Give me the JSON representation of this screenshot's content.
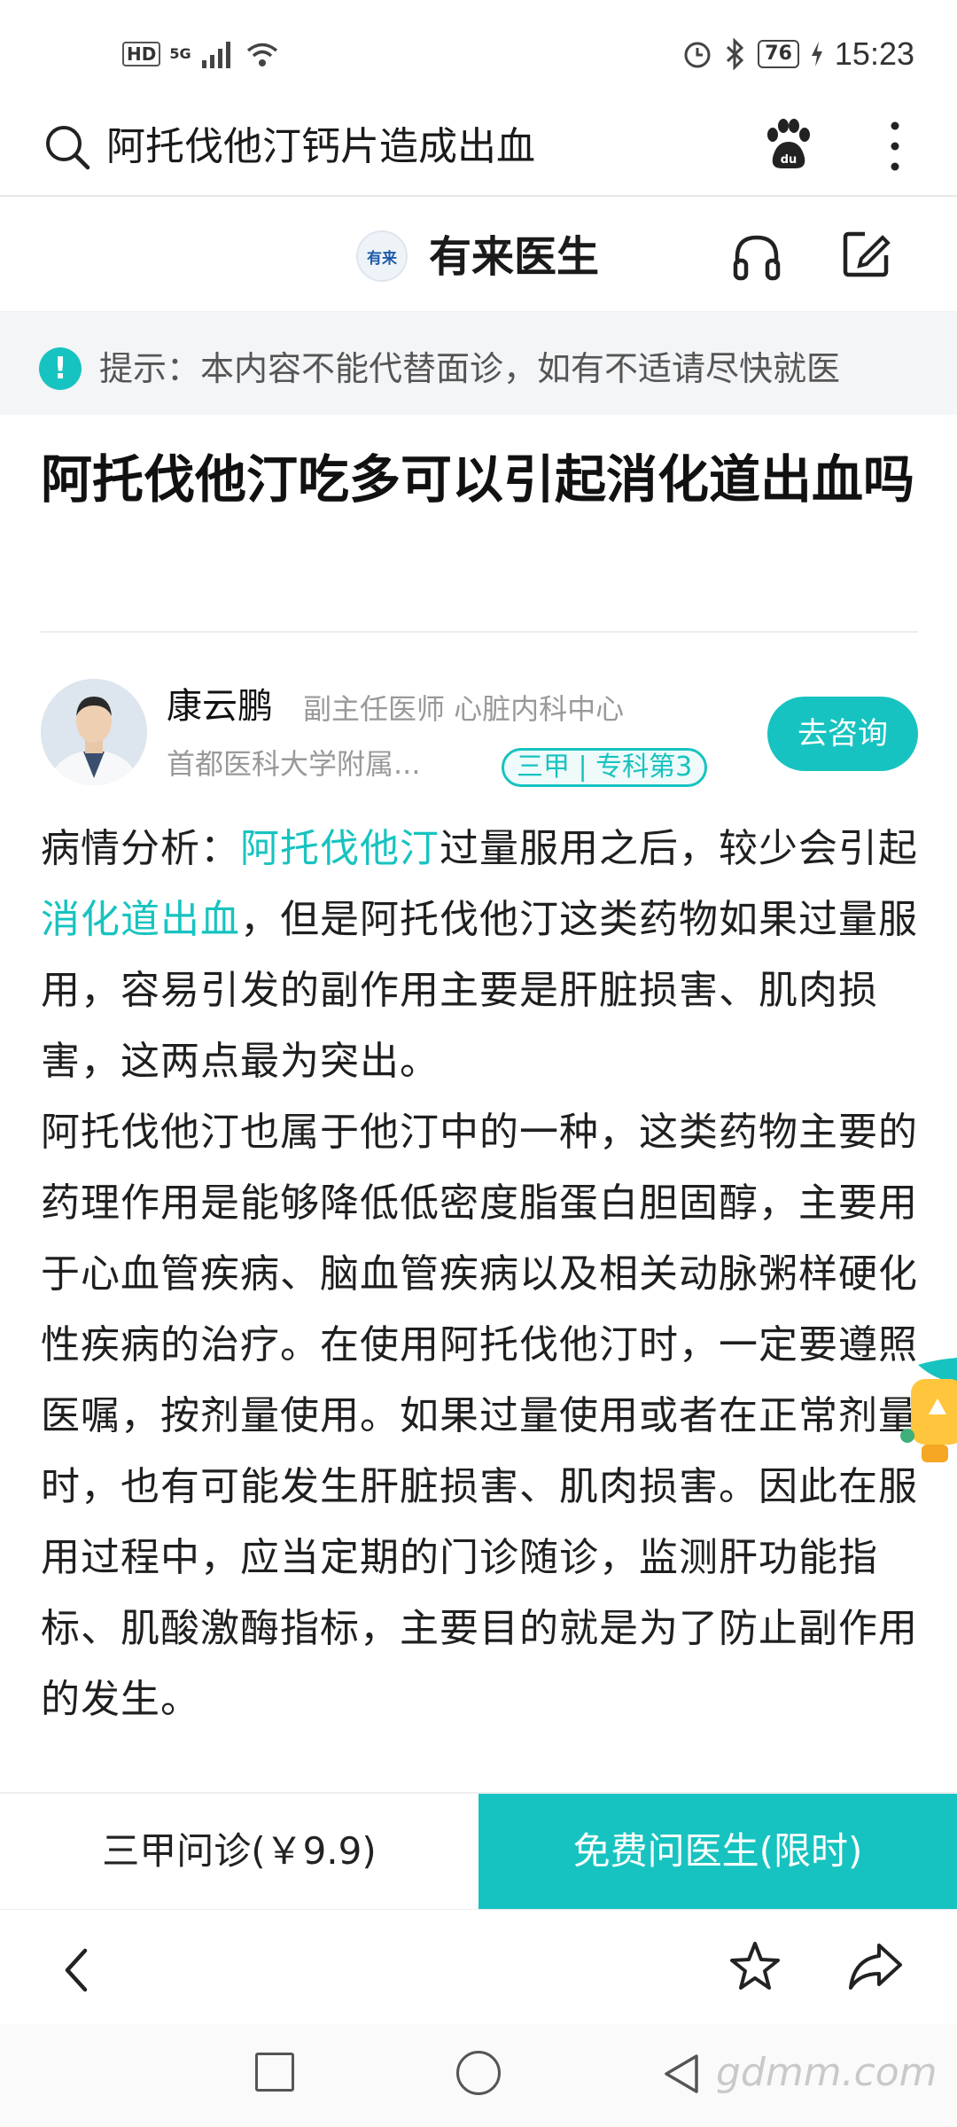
{
  "status_bar": {
    "hd": "HD",
    "network": "5G",
    "battery": "76",
    "time": "15:23"
  },
  "search": {
    "query": "阿托伐他汀钙片造成出血"
  },
  "site": {
    "logo_text": "有来",
    "name": "有来医生"
  },
  "tip": {
    "icon": "!",
    "text": "提示：本内容不能代替面诊，如有不适请尽快就医"
  },
  "article": {
    "title": "阿托伐他汀吃多可以引起消化道出血吗",
    "doctor": {
      "name": "康云鹏",
      "title": "副主任医师  心脏内科中心",
      "hospital": "首都医科大学附属...",
      "badge": "三甲 | 专科第3",
      "consult_label": "去咨询"
    },
    "body": {
      "p1_lead": "病情分析：",
      "p1_kw1": "阿托伐他汀",
      "p1_part2": "过量服用之后，较少会引起",
      "p1_kw2": "消化道出血",
      "p1_part3": "，但是阿托伐他汀这类药物如果过量服用，容易引发的副作用主要是肝脏损害、肌肉损害，这两点最为突出。",
      "p2": "阿托伐他汀也属于他汀中的一种，这类药物主要的药理作用是能够降低低密度脂蛋白胆固醇，主要用于心血管疾病、脑血管疾病以及相关动脉粥样硬化性疾病的治疗。在使用阿托伐他汀时，一定要遵照医嘱，按剂量使用。如果过量使用或者在正常剂量时，也有可能发生肝脏损害、肌肉损害。因此在服用过程中，应当定期的门诊随诊，监测肝功能指标、肌酸激酶指标，主要目的就是为了防止副作用的发生。"
    }
  },
  "actions": {
    "sanjia_label": "三甲问诊(￥9.9)",
    "free_label": "免费问医生(限时)"
  },
  "watermark": "gdmm.com",
  "colors": {
    "accent": "#17c3c0",
    "text": "#1f1f1f",
    "muted": "#999999"
  },
  "icons": [
    "search-icon",
    "paw-icon",
    "more-icon",
    "headphones-icon",
    "edit-icon",
    "info-icon",
    "back-icon",
    "star-icon",
    "share-icon"
  ]
}
